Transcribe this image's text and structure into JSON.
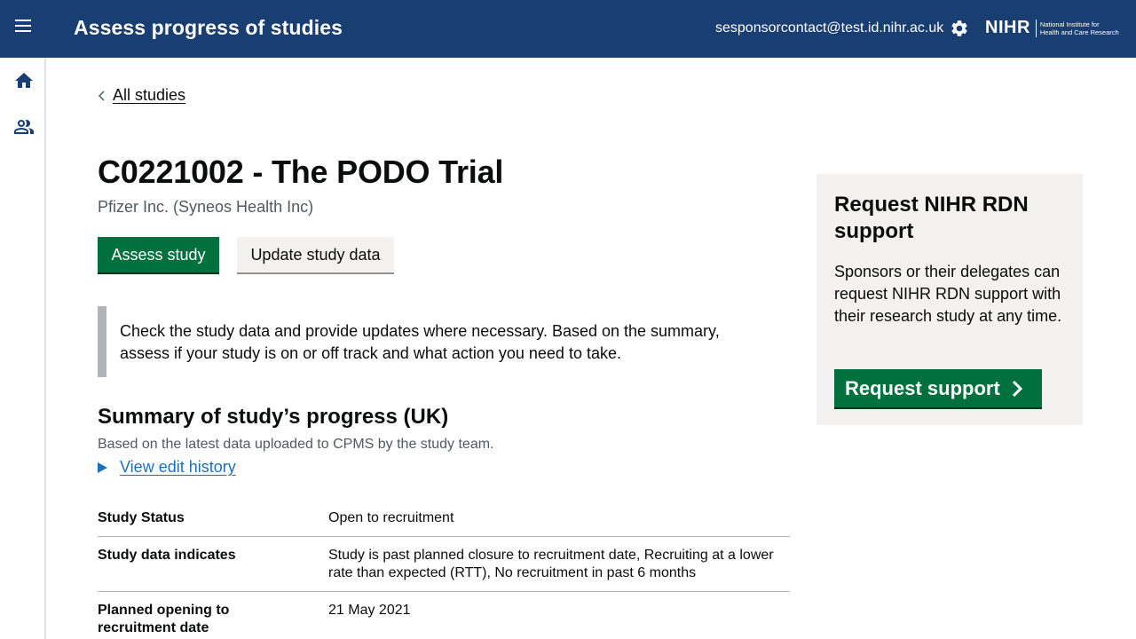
{
  "header": {
    "title": "Assess progress of studies",
    "user_email": "sesponsorcontact@test.id.nihr.ac.uk",
    "logo_mark": "NIHR",
    "logo_line1": "National Institute for",
    "logo_line2": "Health and Care Research",
    "icons": {
      "menu": "hamburger-icon",
      "settings": "gear-icon"
    }
  },
  "sidebar": {
    "items": [
      {
        "icon": "home-icon"
      },
      {
        "icon": "people-icon"
      }
    ]
  },
  "breadcrumb": {
    "back_label": "All studies"
  },
  "study": {
    "title": "C0221002 - The PODO Trial",
    "sponsor": "Pfizer Inc. (Syneos Health Inc)"
  },
  "actions": {
    "assess_label": "Assess study",
    "update_label": "Update study data"
  },
  "inset_text": "Check the study data and provide updates where necessary. Based on the summary, assess if your study is on or off track and what action you need to take.",
  "summary": {
    "title": "Summary of study’s progress (UK)",
    "subtitle": "Based on the latest data uploaded to CPMS by the study team.",
    "history_link": "View edit history",
    "rows": [
      {
        "key": "Study Status",
        "value": "Open to recruitment"
      },
      {
        "key": "Study data indicates",
        "value": "Study is past planned closure to recruitment date, Recruiting at a lower rate than expected (RTT), No recruitment in past 6 months"
      },
      {
        "key": "Planned opening to recruitment date",
        "value": "21 May 2021"
      }
    ]
  },
  "aside": {
    "title": "Request NIHR RDN support",
    "body": "Sponsors or their delegates can request NIHR RDN support with their research study at any time.",
    "button_label": "Request support"
  },
  "colors": {
    "header_bg": "#193e72",
    "primary_green": "#00703c",
    "link_blue": "#1d70b8",
    "inset_border": "#b1b4b6",
    "aside_bg": "#f3f2f1"
  }
}
